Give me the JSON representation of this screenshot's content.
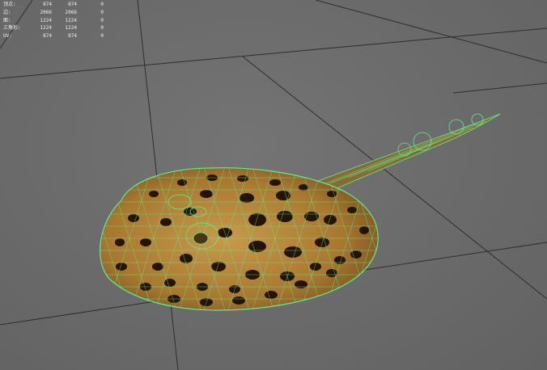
{
  "viewport": {
    "name": "3d-perspective-viewport",
    "background": "#6d6d6d",
    "grid_color": "#2e2e2e",
    "wireframe_color": "#59f08e",
    "texture_base_color": "#b98a3c",
    "spot_color": "#241405"
  },
  "hud": {
    "rows": [
      {
        "label": "顶点:",
        "v1": "874",
        "v2": "874",
        "v3": "0"
      },
      {
        "label": "边:",
        "v1": "2066",
        "v2": "2066",
        "v3": "0"
      },
      {
        "label": "面:",
        "v1": "1224",
        "v2": "1224",
        "v3": "0"
      },
      {
        "label": "三角形:",
        "v1": "1224",
        "v2": "1224",
        "v3": "0"
      },
      {
        "label": "UV:",
        "v1": "874",
        "v2": "874",
        "v3": "0"
      }
    ]
  }
}
